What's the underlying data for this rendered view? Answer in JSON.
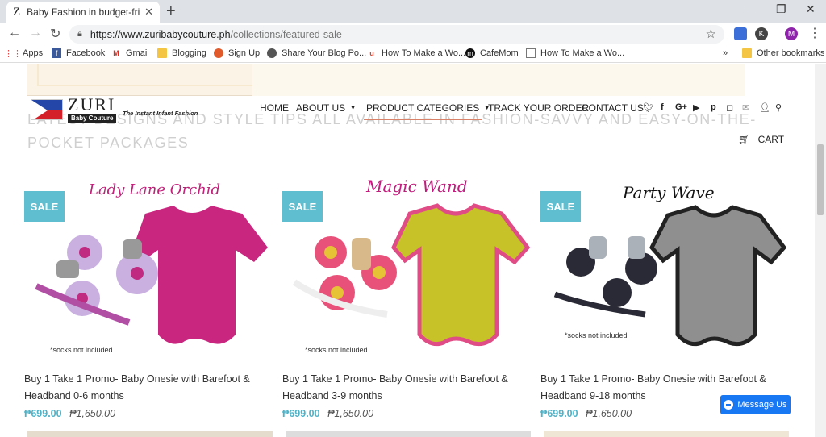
{
  "browser": {
    "tab_title": "Baby Fashion in budget-friendly",
    "tab_favicon": "Z",
    "url_host": "https://www.zuribabycouture.ph",
    "url_path": "/collections/featured-sale",
    "profile_letter": "M",
    "ext_letter": "K",
    "bookmarks": [
      {
        "label": "Apps",
        "icon": "apps-grid-icon"
      },
      {
        "label": "Facebook",
        "icon": "facebook-icon"
      },
      {
        "label": "Gmail",
        "icon": "gmail-icon"
      },
      {
        "label": "Blogging",
        "icon": "folder-icon"
      },
      {
        "label": "Sign Up",
        "icon": "sign-up-icon"
      },
      {
        "label": "Share Your Blog Po...",
        "icon": "share-blog-icon"
      },
      {
        "label": "How To Make a Wo...",
        "icon": "wordpress-icon"
      },
      {
        "label": "CafeMom",
        "icon": "cafemom-icon"
      },
      {
        "label": "How To Make a Wo...",
        "icon": "page-icon"
      }
    ],
    "bookmarks_overflow": "»",
    "other_bookmarks": "Other bookmarks"
  },
  "site": {
    "logo_main": "ZURI",
    "logo_sub": "Baby Couture",
    "logo_tagline": "The Instant Infant Fashion",
    "ghost_tagline": "LATEST DESIGNS AND STYLE TIPS ALL AVAILABLE IN FASHION-SAVVY AND EASY-ON-THE-POCKET PACKAGES",
    "nav": {
      "home": "HOME",
      "about": "ABOUT US",
      "categories": "PRODUCT CATEGORIES",
      "track": "TRACK YOUR ORDER",
      "contact": "CONTACT US"
    },
    "cart": "CART",
    "messenger": "Message Us"
  },
  "colors": {
    "sale_badge": "#5fbfd0",
    "price": "#4fb3c8",
    "nav_underline": "#d9826a",
    "messenger": "#1877f2"
  },
  "products": [
    {
      "badge": "SALE",
      "art_title": "Lady Lane Orchid",
      "art_color": "#c0227a",
      "note": "*socks not included",
      "title_line1": "Buy 1 Take 1 Promo- Baby Onesie with Barefoot &",
      "title_line2": "Headband 0-6 months",
      "price": "₱699.00",
      "compare_price": "₱1,650.00"
    },
    {
      "badge": "SALE",
      "art_title": "Magic Wand",
      "art_color": "#c21c7e",
      "note": "*socks not included",
      "title_line1": "Buy 1 Take 1 Promo- Baby Onesie with Barefoot &",
      "title_line2": "Headband 3-9 months",
      "price": "₱699.00",
      "compare_price": "₱1,650.00"
    },
    {
      "badge": "SALE",
      "art_title": "Party Wave",
      "art_color": "#111111",
      "note": "*socks not included",
      "title_line1": "Buy 1 Take 1 Promo- Baby Onesie with Barefoot &",
      "title_line2": "Headband 9-18 months",
      "price": "₱699.00",
      "compare_price": "₱1,650.00"
    }
  ]
}
